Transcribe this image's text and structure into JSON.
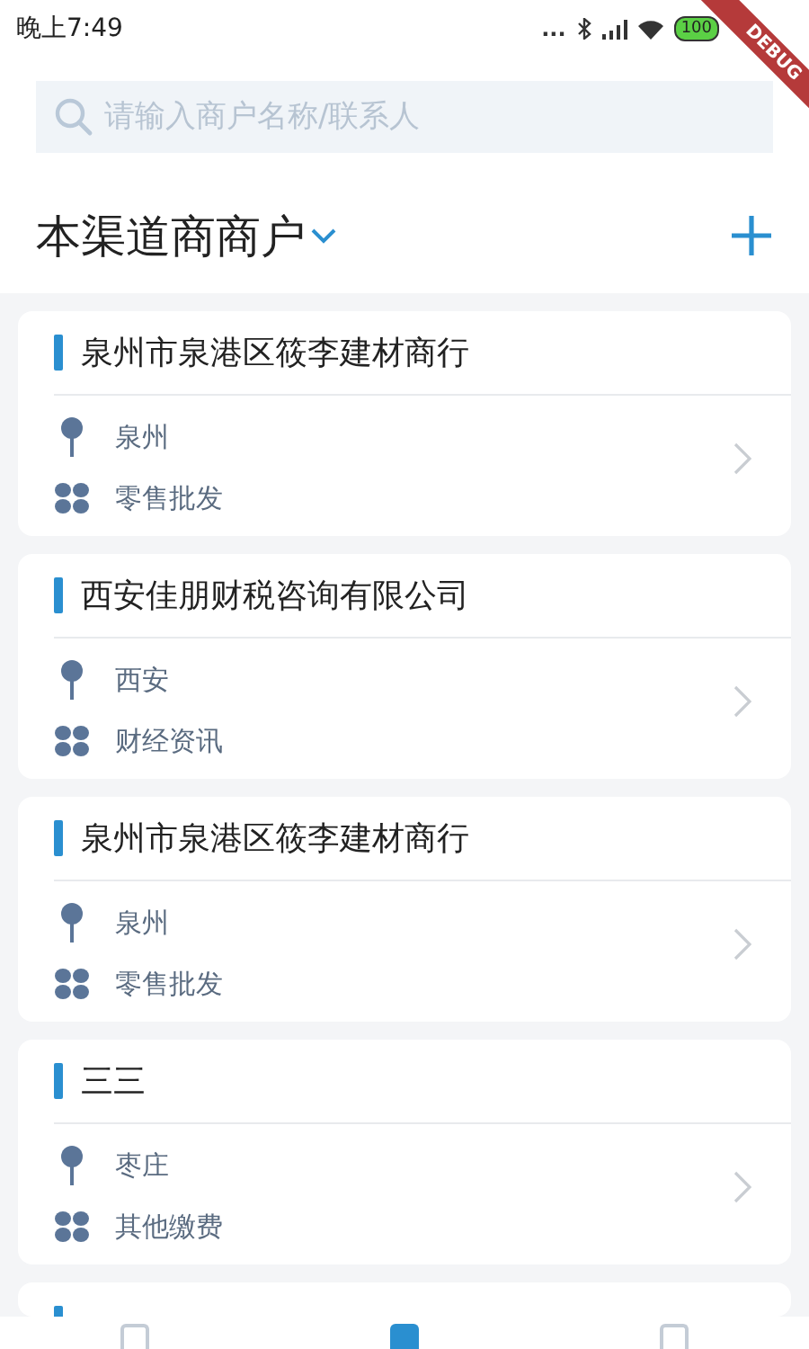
{
  "status_bar": {
    "time": "晚上7:49",
    "dots": "...",
    "battery": "100"
  },
  "debug_banner": "DEBUG",
  "search": {
    "placeholder": "请输入商户名称/联系人"
  },
  "header": {
    "title": "本渠道商商户"
  },
  "merchants": [
    {
      "name": "泉州市泉港区筱李建材商行",
      "city": "泉州",
      "category": "零售批发"
    },
    {
      "name": "西安佳朋财税咨询有限公司",
      "city": "西安",
      "category": "财经资讯"
    },
    {
      "name": "泉州市泉港区筱李建材商行",
      "city": "泉州",
      "category": "零售批发"
    },
    {
      "name": "三三",
      "city": "枣庄",
      "category": "其他缴费"
    }
  ],
  "bottom_nav": [
    {
      "selected": false
    },
    {
      "selected": true
    },
    {
      "selected": false
    }
  ]
}
